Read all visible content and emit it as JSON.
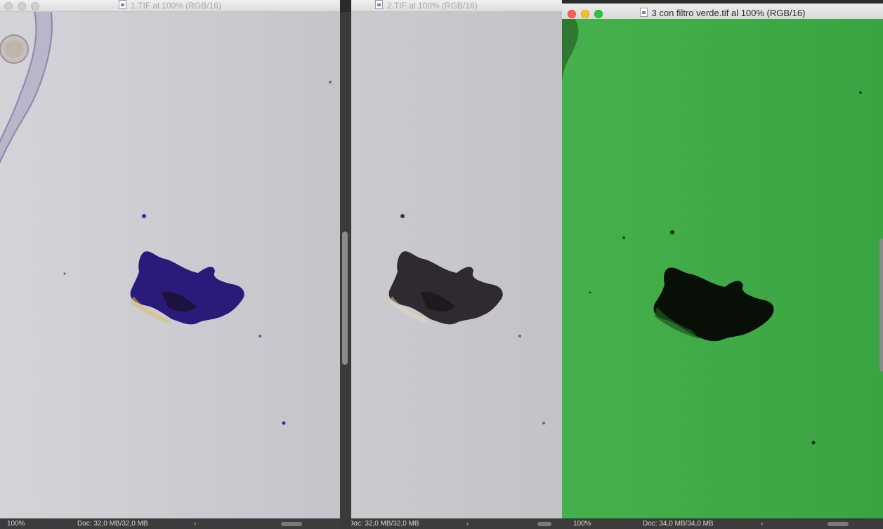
{
  "windows": [
    {
      "title": "1.TIF al 100% (RGB/16)",
      "zoom": "100%",
      "doc_info": "Doc: 32,0 MB/32,0 MB",
      "active": false
    },
    {
      "title": "2.TIF al 100% (RGB/16)",
      "zoom": "100%",
      "doc_info": "Doc: 32,0 MB/32,0 MB",
      "active": false
    },
    {
      "title": "3 con filtro verde.tif al 100% (RGB/16)",
      "zoom": "100%",
      "doc_info": "Doc: 34,0 MB/34,0 MB",
      "active": true
    }
  ],
  "status_arrow": "›",
  "colors": {
    "image1_background": "#c9c9cf",
    "image2_background": "#c6c6c9",
    "image3_background": "#3dab45",
    "specimen_purple": "#2a1a7a",
    "specimen_gray": "#2e2a2f",
    "specimen_green_dark": "#070f07"
  }
}
